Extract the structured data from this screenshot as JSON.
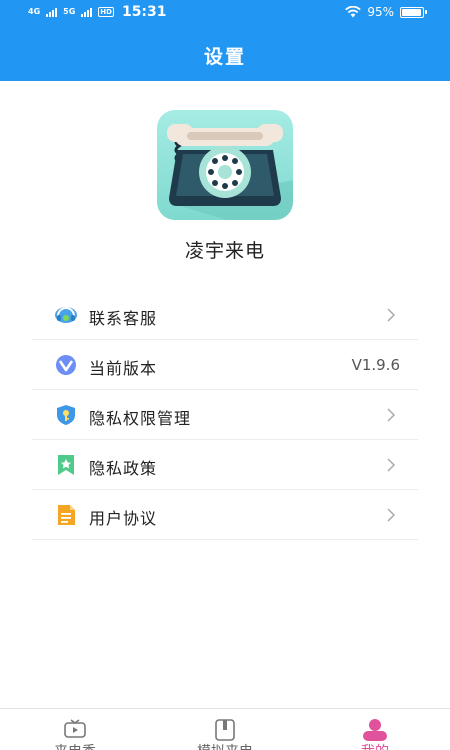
{
  "status_bar": {
    "network_1": "4G",
    "network_2": "5G",
    "hd": "HD",
    "time": "15:31",
    "battery": "95%",
    "battery_level": 0.95
  },
  "header": {
    "title": "设置"
  },
  "app": {
    "name": "凌宇来电"
  },
  "menu": {
    "items": [
      {
        "label": "联系客服",
        "icon": "customer-service-icon"
      },
      {
        "label": "当前版本",
        "icon": "version-icon",
        "value": "V1.9.6"
      },
      {
        "label": "隐私权限管理",
        "icon": "privacy-permission-icon"
      },
      {
        "label": "隐私政策",
        "icon": "privacy-policy-icon"
      },
      {
        "label": "用户协议",
        "icon": "user-agreement-icon"
      }
    ]
  },
  "bottom_nav": {
    "tabs": [
      {
        "label": "来电秀",
        "icon": "tv-icon"
      },
      {
        "label": "模拟来电",
        "icon": "simulate-call-icon"
      },
      {
        "label": "我的",
        "icon": "profile-icon",
        "active": true
      }
    ]
  },
  "colors": {
    "header_bg": "#2196f3",
    "active_tab": "#e0529c",
    "logo_bg": "#8fe0d6"
  }
}
